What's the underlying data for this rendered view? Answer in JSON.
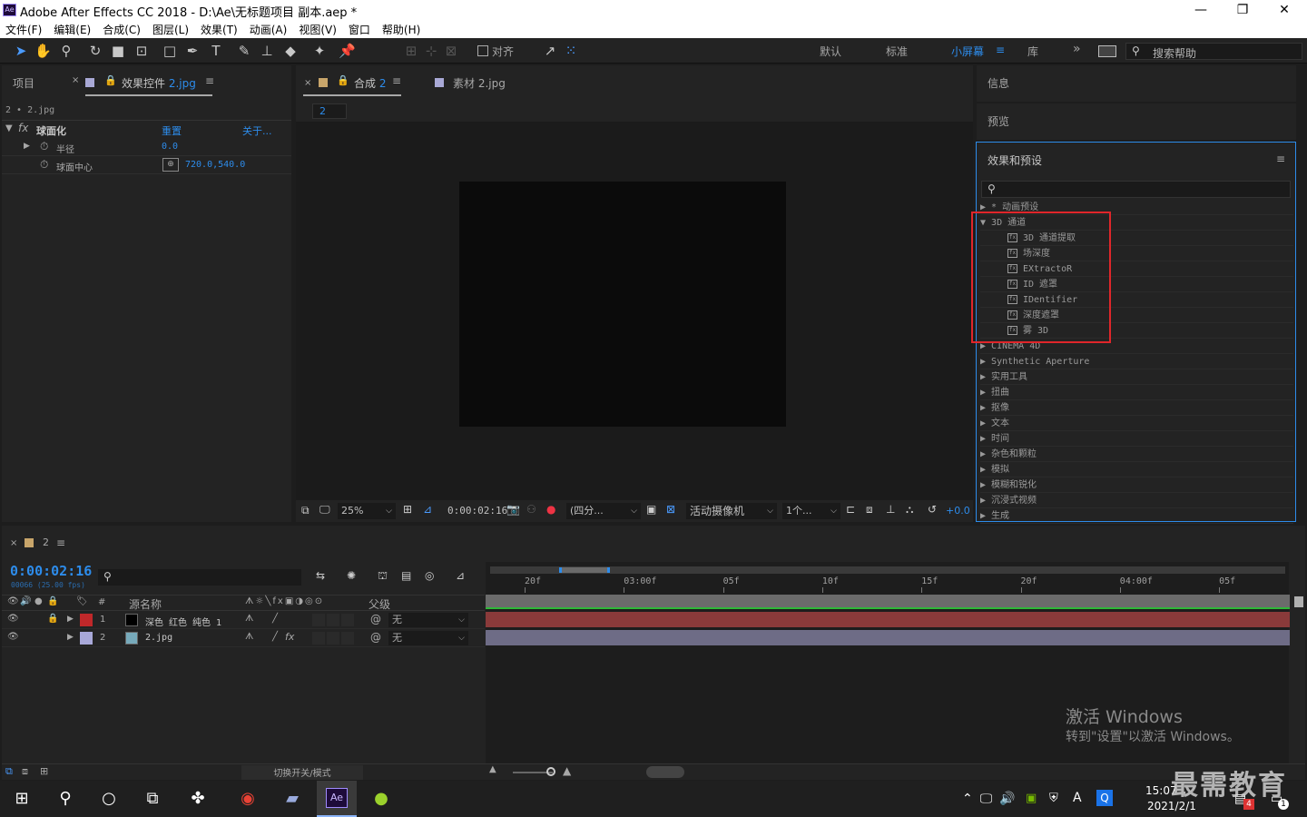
{
  "window": {
    "title": "Adobe After Effects CC 2018 - D:\\Ae\\无标题项目 副本.aep *",
    "icon": "Ae",
    "minimize": "—",
    "maximize": "❐",
    "close": "✕"
  },
  "menu": [
    "文件(F)",
    "编辑(E)",
    "合成(C)",
    "图层(L)",
    "效果(T)",
    "动画(A)",
    "视图(V)",
    "窗口",
    "帮助(H)"
  ],
  "toolbar": {
    "snap_label": "对齐",
    "workspaces": [
      "默认",
      "标准",
      "小屏幕",
      "库"
    ],
    "active_workspace": "小屏幕",
    "search_placeholder": "搜索帮助",
    "more": "»"
  },
  "left_panel": {
    "tab_project": "项目",
    "tab_effects": "效果控件",
    "tab_effects_file": "2.jpg",
    "breadcrumb": "2 • 2.jpg",
    "effect_name": "球面化",
    "reset": "重置",
    "about": "关于...",
    "props": [
      {
        "name": "半径",
        "value": "0.0"
      },
      {
        "name": "球面中心",
        "value": "720.0,540.0"
      }
    ]
  },
  "comp_panel": {
    "tab_comp": "合成",
    "tab_comp_num": "2",
    "tab_footage": "素材 2.jpg",
    "comp_badge": "2",
    "zoom": "25%",
    "timecode": "0:00:02:16",
    "resolution": "(四分...",
    "camera": "活动摄像机",
    "views": "1个...",
    "exposure": "+0.0"
  },
  "right_panel": {
    "info": "信息",
    "preview": "预览",
    "effects_title": "效果和预设",
    "search_placeholder": "",
    "items": [
      {
        "label": "* 动画预设",
        "expanded": false,
        "level": 0
      },
      {
        "label": "3D 通道",
        "expanded": true,
        "level": 0
      },
      {
        "label": "3D 通道提取",
        "level": 1
      },
      {
        "label": "场深度",
        "level": 1
      },
      {
        "label": "EXtractoR",
        "level": 1
      },
      {
        "label": "ID 遮罩",
        "level": 1
      },
      {
        "label": "IDentifier",
        "level": 1
      },
      {
        "label": "深度遮罩",
        "level": 1
      },
      {
        "label": "雾 3D",
        "level": 1
      },
      {
        "label": "CINEMA 4D",
        "expanded": false,
        "level": 0
      },
      {
        "label": "Synthetic Aperture",
        "expanded": false,
        "level": 0
      },
      {
        "label": "实用工具",
        "expanded": false,
        "level": 0
      },
      {
        "label": "扭曲",
        "expanded": false,
        "level": 0
      },
      {
        "label": "抠像",
        "expanded": false,
        "level": 0
      },
      {
        "label": "文本",
        "expanded": false,
        "level": 0
      },
      {
        "label": "时间",
        "expanded": false,
        "level": 0
      },
      {
        "label": "杂色和颗粒",
        "expanded": false,
        "level": 0
      },
      {
        "label": "模拟",
        "expanded": false,
        "level": 0
      },
      {
        "label": "模糊和锐化",
        "expanded": false,
        "level": 0
      },
      {
        "label": "沉浸式视频",
        "expanded": false,
        "level": 0
      },
      {
        "label": "生成",
        "expanded": false,
        "level": 0
      }
    ],
    "highlight_color": "#e0262a"
  },
  "timeline": {
    "tab": "2",
    "timecode": "0:00:02:16",
    "frame_info": "00066 (25.00 fps)",
    "col_source": "源名称",
    "col_parent": "父级",
    "col_num": "#",
    "layers": [
      {
        "num": "1",
        "name": "深色 红色 纯色 1",
        "color": "#c0282a",
        "parent": "无",
        "bar_color": "#8a3a3a"
      },
      {
        "num": "2",
        "name": "2.jpg",
        "color": "#a8a8d8",
        "parent": "无",
        "bar_color": "#6e6c86"
      }
    ],
    "ruler": [
      "20f",
      "03:00f",
      "05f",
      "10f",
      "15f",
      "20f",
      "04:00f",
      "05f"
    ],
    "toggle_label": "切换开关/模式"
  },
  "watermark": {
    "line1": "激活 Windows",
    "line2": "转到\"设置\"以激活 Windows。"
  },
  "brand": "最需教育",
  "taskbar": {
    "time": "15:07",
    "date": "2021/2/1",
    "ime": "A",
    "notif_badge": "4",
    "msg_badge": "1"
  }
}
